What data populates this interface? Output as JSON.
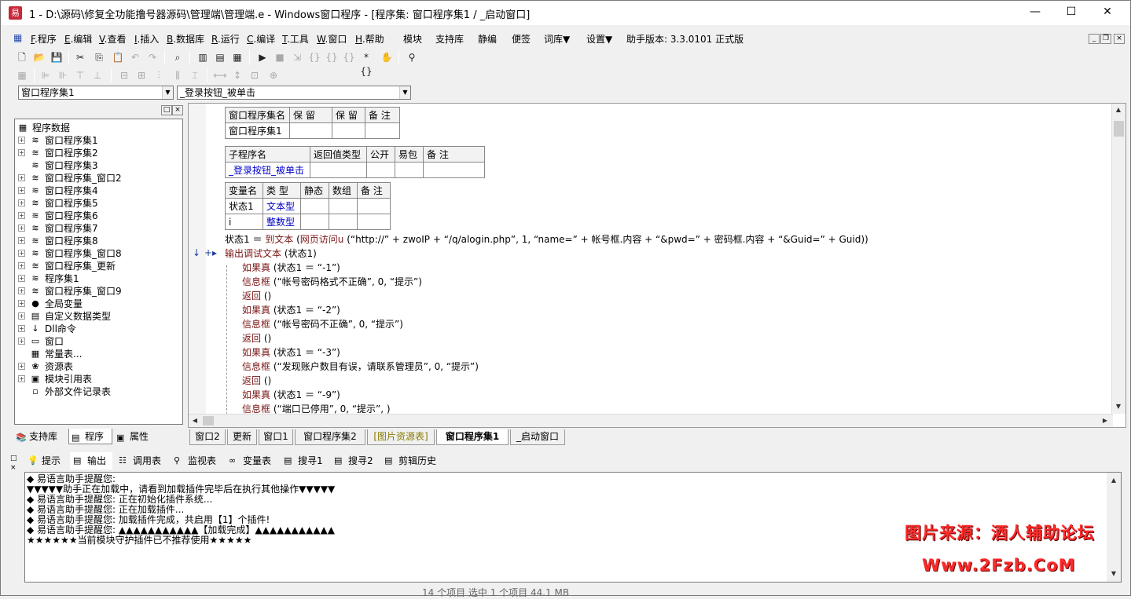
{
  "window": {
    "title": "1 - D:\\源码\\修复全功能撸号器源码\\管理端\\管理端.e - Windows窗口程序 - [程序集: 窗口程序集1 / _启动窗口]",
    "minimize": "—",
    "maximize": "☐",
    "close": "✕"
  },
  "menu": {
    "items": [
      {
        "key": "F",
        "label": ".程序"
      },
      {
        "key": "E",
        "label": ".编辑"
      },
      {
        "key": "V",
        "label": ".查看"
      },
      {
        "key": "I",
        "label": ".插入"
      },
      {
        "key": "B",
        "label": ".数据库"
      },
      {
        "key": "R",
        "label": ".运行"
      },
      {
        "key": "C",
        "label": ".编译"
      },
      {
        "key": "T",
        "label": ".工具"
      },
      {
        "key": "W",
        "label": ".窗口"
      },
      {
        "key": "H",
        "label": ".帮助"
      }
    ],
    "extra": [
      "模块",
      "支持库",
      "静编",
      "便签",
      "词库▼",
      "设置▼"
    ],
    "version": "助手版本: 3.3.0101 正式版"
  },
  "combos": {
    "class_select": "窗口程序集1",
    "method_select": "_登录按钮_被单击"
  },
  "tree": {
    "root": "程序数据",
    "items": [
      {
        "label": "窗口程序集1",
        "pm": "+",
        "icon": "≋"
      },
      {
        "label": "窗口程序集2",
        "pm": "+",
        "icon": "≋"
      },
      {
        "label": "窗口程序集3",
        "pm": "",
        "icon": "≋"
      },
      {
        "label": "窗口程序集_窗口2",
        "pm": "+",
        "icon": "≋"
      },
      {
        "label": "窗口程序集4",
        "pm": "+",
        "icon": "≋"
      },
      {
        "label": "窗口程序集5",
        "pm": "+",
        "icon": "≋"
      },
      {
        "label": "窗口程序集6",
        "pm": "+",
        "icon": "≋"
      },
      {
        "label": "窗口程序集7",
        "pm": "+",
        "icon": "≋"
      },
      {
        "label": "窗口程序集8",
        "pm": "+",
        "icon": "≋"
      },
      {
        "label": "窗口程序集_窗口8",
        "pm": "+",
        "icon": "≋"
      },
      {
        "label": "窗口程序集_更新",
        "pm": "+",
        "icon": "≋"
      },
      {
        "label": "程序集1",
        "pm": "+",
        "icon": "≋"
      },
      {
        "label": "窗口程序集_窗口9",
        "pm": "+",
        "icon": "≋"
      },
      {
        "label": "全局变量",
        "pm": "+",
        "icon": "●"
      },
      {
        "label": "自定义数据类型",
        "pm": "+",
        "icon": "▤"
      },
      {
        "label": "Dll命令",
        "pm": "+",
        "icon": "↓"
      },
      {
        "label": "窗口",
        "pm": "+",
        "icon": "▭"
      },
      {
        "label": "常量表...",
        "pm": "",
        "icon": "▦"
      },
      {
        "label": "资源表",
        "pm": "+",
        "icon": "❀"
      },
      {
        "label": "模块引用表",
        "pm": "+",
        "icon": "▣"
      },
      {
        "label": "外部文件记录表",
        "pm": "",
        "icon": "▫"
      }
    ]
  },
  "left_tabs": [
    "支持库",
    "程序",
    "属性"
  ],
  "table1": {
    "headers": [
      "窗口程序集名",
      "保 留",
      "保 留",
      "备 注"
    ],
    "row": [
      "窗口程序集1",
      "",
      "",
      ""
    ]
  },
  "table2": {
    "headers": [
      "子程序名",
      "返回值类型",
      "公开",
      "易包",
      "备 注"
    ],
    "row": [
      "_登录按钮_被单击",
      "",
      "",
      "",
      ""
    ]
  },
  "table3": {
    "headers": [
      "变量名",
      "类 型",
      "静态",
      "数组",
      "备 注"
    ],
    "rows": [
      [
        "状态1",
        "文本型",
        "",
        "",
        ""
      ],
      [
        "i",
        "整数型",
        "",
        "",
        ""
      ]
    ]
  },
  "code": {
    "l1_var": "状态1",
    "l1_eq": " ＝ ",
    "l1_fn": "到文本",
    "l1_open": " (",
    "l1_fn2": "网页访问u",
    "l1_rest": " (“http://” + zwoIP + “/q/alogin.php”, 1, “name=” + 帐号框.内容 + “&pwd=” + 密码框.内容 + “&Guid=” + Guid))",
    "l2_fn": "输出调试文本",
    "l2_rest": " (状态1)",
    "if_kw": "如果真",
    "ret_kw": "返回",
    "msg_kw": "信息框",
    "blocks": [
      {
        "cond": " (状态1 ＝ “-1”)",
        "msg": " (“帐号密码格式不正确”, 0, “提示”)",
        "ret": " ()"
      },
      {
        "cond": " (状态1 ＝ “-2”)",
        "msg": " (“帐号密码不正确”, 0, “提示”)",
        "ret": " ()"
      },
      {
        "cond": " (状态1 ＝ “-3”)",
        "msg": " (“发现账户数目有误，请联系管理员”, 0, “提示”)",
        "ret": " ()"
      },
      {
        "cond": " (状态1 ＝ “-9”)",
        "msg": " (“端口已停用”, 0, “提示”, )",
        "ret": ""
      }
    ]
  },
  "editor_tabs": [
    "窗口2",
    "更新",
    "窗口1",
    "窗口程序集2",
    "[图片资源表]",
    "窗口程序集1",
    "_启动窗口"
  ],
  "bottom_tabs": [
    "提示",
    "输出",
    "调用表",
    "监视表",
    "变量表",
    "搜寻1",
    "搜寻2",
    "剪辑历史"
  ],
  "output": [
    "◆ 易语言助手提醒您:",
    "▼▼▼▼▼助手正在加载中，请看到加载插件完毕后在执行其他操作▼▼▼▼▼",
    "◆ 易语言助手提醒您: 正在初始化插件系统...",
    "◆ 易语言助手提醒您: 正在加载插件...",
    "◆ 易语言助手提醒您: 加载插件完成，共启用【1】个插件!",
    "◆ 易语言助手提醒您: ▲▲▲▲▲▲▲▲▲▲▲【加载完成】▲▲▲▲▲▲▲▲▲▲▲",
    "★★★★★★当前模块守护插件已不推荐使用★★★★★"
  ],
  "watermark": {
    "line1": "图片来源：酒人辅助论坛",
    "line2": "Www.2Fzb.CoM"
  },
  "statusbar": "14 个项目    选中 1 个项目  44.1 MB",
  "colors": {
    "keyword": "#7a1515",
    "type": "#0000c8",
    "watermark": "#ff2a2a"
  }
}
